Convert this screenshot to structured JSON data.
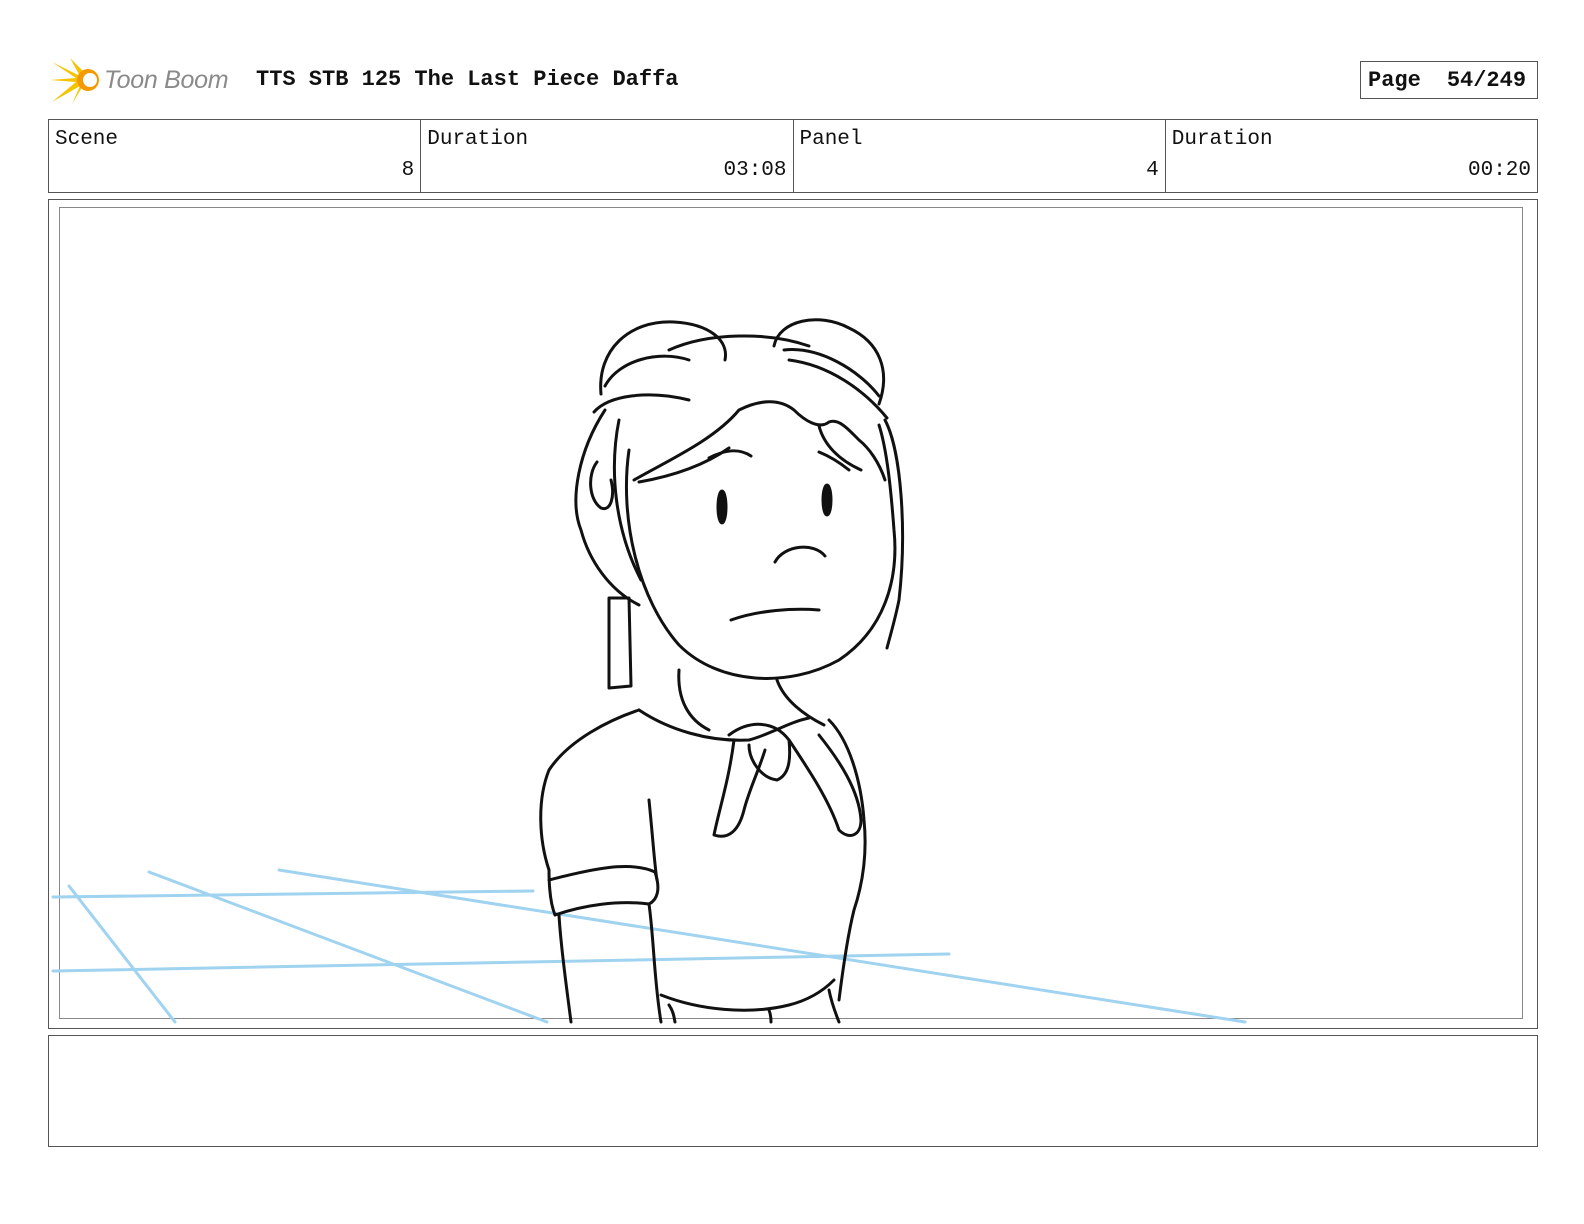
{
  "header": {
    "logo_icon": "toon-boom-starburst-icon",
    "logo_text": "Toon Boom",
    "title": "TTS STB 125 The Last Piece Daffa",
    "page_label": "Page",
    "page_value": "54/249"
  },
  "info": {
    "scene_label": "Scene",
    "scene_value": "8",
    "scene_duration_label": "Duration",
    "scene_duration_value": "03:08",
    "panel_label": "Panel",
    "panel_value": "4",
    "panel_duration_label": "Duration",
    "panel_duration_value": "00:20"
  },
  "colors": {
    "logo_yellow": "#f5c400",
    "logo_orange": "#f39a00",
    "guide_blue": "#9fd3ef",
    "sketch_ink": "#111111"
  },
  "panel": {
    "image": "storyboard-sketch-girl-worried-expression"
  },
  "notes": {
    "text": ""
  }
}
